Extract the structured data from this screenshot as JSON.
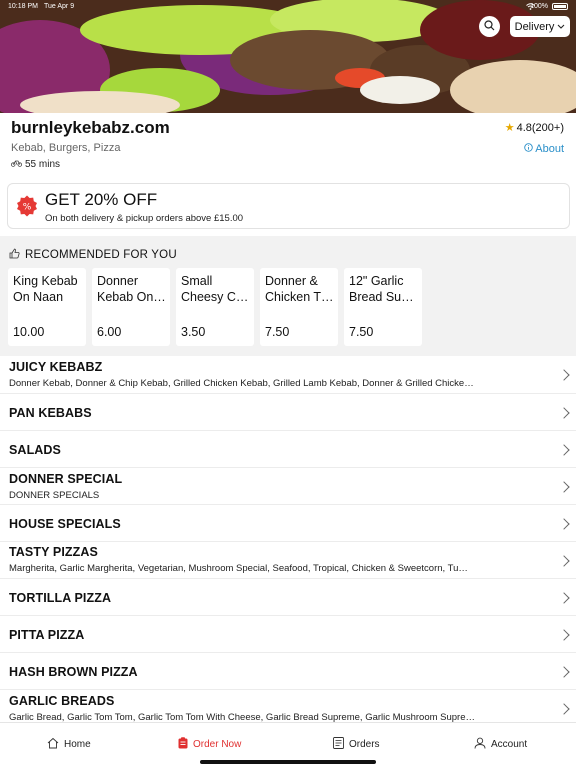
{
  "status_bar": {
    "time": "10:18 PM",
    "date": "Tue Apr 9",
    "battery": "100%"
  },
  "header": {
    "fulfilment_mode": "Delivery"
  },
  "store": {
    "name": "burnleykebabz.com",
    "rating": "4.8(200+)",
    "cuisines": "Kebab, Burgers, Pizza",
    "about_label": "About",
    "delivery_time": "55 mins"
  },
  "offer": {
    "title": "GET 20% OFF",
    "subtitle": "On both delivery & pickup orders above £15.00"
  },
  "recommended": {
    "title": "RECOMMENDED FOR YOU",
    "items": [
      {
        "name": "King Kebab On Naan",
        "price": "10.00"
      },
      {
        "name": "Donner Kebab On…",
        "price": "6.00"
      },
      {
        "name": "Small Cheesy C…",
        "price": "3.50"
      },
      {
        "name": "Donner & Chicken T…",
        "price": "7.50"
      },
      {
        "name": "12\" Garlic Bread Su…",
        "price": "7.50"
      }
    ]
  },
  "categories": [
    {
      "title": "JUICY KEBABZ",
      "subtitle": "Donner Kebab, Donner & Chip Kebab, Grilled Chicken Kebab, Grilled Lamb Kebab, Donner & Grilled Chicke…"
    },
    {
      "title": "PAN KEBABS",
      "subtitle": ""
    },
    {
      "title": "SALADS",
      "subtitle": ""
    },
    {
      "title": "DONNER SPECIAL",
      "subtitle": "DONNER SPECIALS"
    },
    {
      "title": "HOUSE SPECIALS",
      "subtitle": ""
    },
    {
      "title": "TASTY PIZZAS",
      "subtitle": "Margherita, Garlic Margherita, Vegetarian, Mushroom Special, Seafood, Tropical, Chicken & Sweetcorn, Tu…"
    },
    {
      "title": "TORTILLA PIZZA",
      "subtitle": ""
    },
    {
      "title": "PITTA PIZZA",
      "subtitle": ""
    },
    {
      "title": "HASH BROWN PIZZA",
      "subtitle": ""
    },
    {
      "title": "GARLIC BREADS",
      "subtitle": "Garlic Bread, Garlic Tom Tom, Garlic Tom Tom With Cheese, Garlic Bread Supreme, Garlic Mushroom Supre…"
    }
  ],
  "bottom_nav": {
    "home": "Home",
    "order_now": "Order Now",
    "orders": "Orders",
    "account": "Account"
  },
  "colors": {
    "accent": "#e03030",
    "link": "#2a8fc9",
    "star": "#e6a800",
    "offer_badge": "#e53935"
  },
  "icons": [
    "search-icon",
    "chevron-down-icon",
    "star-icon",
    "info-icon",
    "bike-icon",
    "discount-badge-icon",
    "thumbs-up-icon",
    "chevron-right-icon",
    "home-icon",
    "order-icon",
    "receipt-icon",
    "user-icon",
    "wifi-icon",
    "battery-icon"
  ]
}
